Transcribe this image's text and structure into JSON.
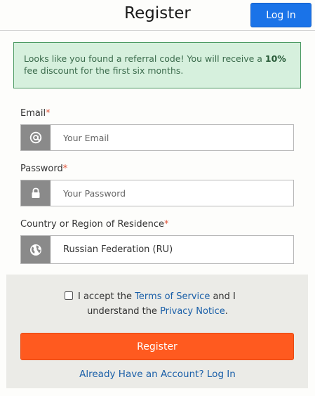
{
  "header": {
    "title": "Register",
    "login_label": "Log In",
    "login_color": "#1a73e8"
  },
  "alert": {
    "text_before": "Looks like you found a referral code! You will receive a ",
    "highlight": "10%",
    "text_after": " fee discount for the first six months."
  },
  "form": {
    "email": {
      "label": "Email",
      "required_mark": "*",
      "placeholder": "Your Email",
      "icon": "at-icon"
    },
    "password": {
      "label": "Password",
      "required_mark": "*",
      "placeholder": "Your Password",
      "icon": "lock-icon"
    },
    "country": {
      "label": "Country or Region of Residence",
      "required_mark": "*",
      "value": "Russian Federation (RU)",
      "icon": "globe-icon"
    }
  },
  "terms": {
    "checked": false,
    "text_1": "I accept the ",
    "tos_link": "Terms of Service",
    "text_2": " and I",
    "text_3": "understand the ",
    "privacy_link": "Privacy Notice",
    "text_4": "."
  },
  "actions": {
    "register_label": "Register",
    "register_color": "#ff5a1f",
    "already_label": "Already Have an Account? Log In"
  }
}
